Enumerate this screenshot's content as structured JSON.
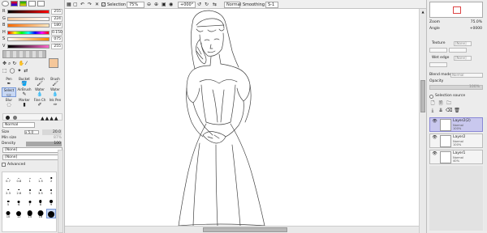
{
  "colors": {
    "panel_bg": "#ececec",
    "active_layer": "#c9c8ee",
    "active_tool": "#c8d8f4",
    "primary_color": "#f5c79a"
  },
  "sliders": [
    {
      "label": "R",
      "value": "255",
      "color": "linear-gradient(90deg,#000,#f00)"
    },
    {
      "label": "G",
      "value": "224",
      "color": "linear-gradient(90deg,#f5c79a,#fff)"
    },
    {
      "label": "B",
      "value": "180",
      "color": "linear-gradient(90deg,#ff6a00,#ffe8c0)"
    },
    {
      "label": "H",
      "value": "0.150",
      "color": "linear-gradient(90deg,#f00,#ff0,#0f0,#0ff,#00f,#f0f,#f00)"
    },
    {
      "label": "S",
      "value": "075",
      "color": "linear-gradient(90deg,#fff,#f80)"
    },
    {
      "label": "V",
      "value": "255",
      "color": "linear-gradient(90deg,#000,#f6c)"
    }
  ],
  "tools": [
    {
      "label": "Pen",
      "icon": "✒"
    },
    {
      "label": "Bucket",
      "icon": "🪣"
    },
    {
      "label": "Brush",
      "icon": "🖌"
    },
    {
      "label": "Brush",
      "icon": "🖌"
    },
    {
      "label": "Select",
      "icon": "▭"
    },
    {
      "label": "AirBrush",
      "icon": "✎"
    },
    {
      "label": "Water",
      "icon": "💧"
    },
    {
      "label": "Water",
      "icon": "💧"
    },
    {
      "label": "Blur",
      "icon": "◌"
    },
    {
      "label": "Marker",
      "icon": "▮"
    },
    {
      "label": "Fine Ch",
      "icon": "✐"
    },
    {
      "label": "Ink Pen",
      "icon": "✑"
    }
  ],
  "tool_props": {
    "blend": "Normal",
    "size_label": "Size",
    "size_mult": "x 5.0",
    "size_value": "20.0",
    "min_size_label": "Min size",
    "min_size_value": "87%",
    "density_label": "Density",
    "density_value": "100",
    "shape1": "[None]",
    "shape2": "[None]",
    "advanced_label": "Advanced"
  },
  "brush_sizes": [
    {
      "label": "0.7",
      "d": 1
    },
    {
      "label": "0.8",
      "d": 1
    },
    {
      "label": "1",
      "d": 1
    },
    {
      "label": "1.5",
      "d": 1
    },
    {
      "label": "2",
      "d": 1.5
    },
    {
      "label": "2.3",
      "d": 1.5
    },
    {
      "label": "2.6",
      "d": 1.5
    },
    {
      "label": "3",
      "d": 2
    },
    {
      "label": "3.5",
      "d": 2
    },
    {
      "label": "4",
      "d": 2
    },
    {
      "label": "5",
      "d": 2.5
    },
    {
      "label": "6",
      "d": 3
    },
    {
      "label": "7",
      "d": 3
    },
    {
      "label": "8",
      "d": 3.5
    },
    {
      "label": "9",
      "d": 4
    },
    {
      "label": "10",
      "d": 5
    },
    {
      "label": "12",
      "d": 6
    },
    {
      "label": "14",
      "d": 6.5
    },
    {
      "label": "16",
      "d": 7
    },
    {
      "label": "20",
      "d": 8
    }
  ],
  "topbar": {
    "selection_label": "Selection",
    "zoom": "75%",
    "angle": "+000°",
    "mode": "Normal",
    "smoothing_label": "Smoothing",
    "smoothing": "S-1"
  },
  "right": {
    "zoom_label": "Zoom",
    "zoom_value": "75.0%",
    "angle_label": "Angle",
    "angle_value": "+0000",
    "texture_label": "Texture",
    "texture_value": "[None]",
    "wet_edge_label": "Wet edge",
    "wet_edge_value": "[None]",
    "blend_mode_label": "Blend mode",
    "blend_mode_value": "Normal",
    "opacity_label": "Opacity",
    "opacity_value": "100%",
    "selection_source_label": "Selection source",
    "layers": [
      {
        "name": "Layer2(2)",
        "mode": "Normal",
        "opacity": "100%",
        "active": true
      },
      {
        "name": "Layer2",
        "mode": "Normal",
        "opacity": "100%",
        "active": false
      },
      {
        "name": "Layer1",
        "mode": "Normal",
        "opacity": "40%",
        "active": false
      }
    ]
  }
}
